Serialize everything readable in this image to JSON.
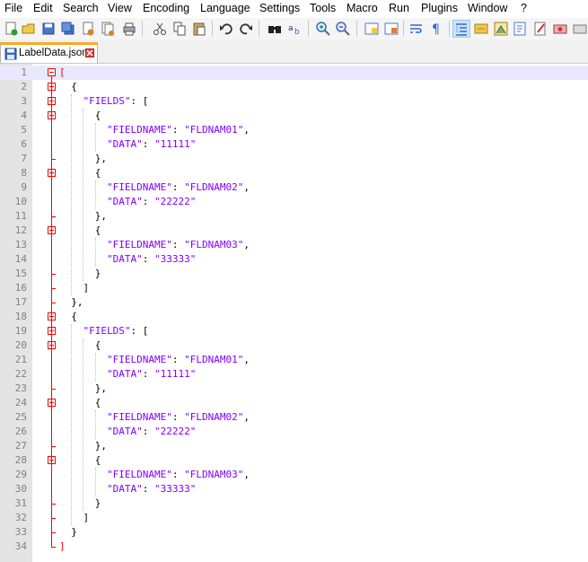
{
  "menu": [
    "File",
    "Edit",
    "Search",
    "View",
    "Encoding",
    "Language",
    "Settings",
    "Tools",
    "Macro",
    "Run",
    "Plugins",
    "Window",
    "?"
  ],
  "toolbar_icons": [
    "new-file-icon",
    "open-file-icon",
    "save-icon",
    "save-all-icon",
    "close-icon",
    "close-all-icon",
    "print-icon",
    "cut-icon",
    "copy-icon",
    "paste-icon",
    "undo-icon",
    "redo-icon",
    "find-icon",
    "replace-icon",
    "zoom-in-icon",
    "zoom-out-icon",
    "sync-vertical-icon",
    "sync-horizontal-icon",
    "word-wrap-icon",
    "show-all-characters-icon",
    "indent-guide-icon",
    "user-defined-language-icon",
    "document-map-icon",
    "function-list-icon",
    "folder-as-workspace-icon",
    "macro-record-icon",
    "macro-stop-icon"
  ],
  "tab": {
    "title": "LabelData.json"
  },
  "editor": {
    "lines": [
      "[",
      "  {",
      "    \"FIELDS\": [",
      "      {",
      "        \"FIELDNAME\": \"FLDNAM01\",",
      "        \"DATA\": \"11111\"",
      "      },",
      "      {",
      "        \"FIELDNAME\": \"FLDNAM02\",",
      "        \"DATA\": \"22222\"",
      "      },",
      "      {",
      "        \"FIELDNAME\": \"FLDNAM03\",",
      "        \"DATA\": \"33333\"",
      "      }",
      "    ]",
      "  },",
      "  {",
      "    \"FIELDS\": [",
      "      {",
      "        \"FIELDNAME\": \"FLDNAM01\",",
      "        \"DATA\": \"11111\"",
      "      },",
      "      {",
      "        \"FIELDNAME\": \"FLDNAM02\",",
      "        \"DATA\": \"22222\"",
      "      },",
      "      {",
      "        \"FIELDNAME\": \"FLDNAM03\",",
      "        \"DATA\": \"33333\"",
      "      }",
      "    ]",
      "  }",
      "]"
    ],
    "current_line": 1
  },
  "colors": {
    "string": "#8000ff",
    "operator": "#000000",
    "outer_bracket": "#ff0000",
    "fold_marker": "#ff0000",
    "tab_accent": "#f9a825",
    "current_line_bg": "#e8e8ff"
  }
}
